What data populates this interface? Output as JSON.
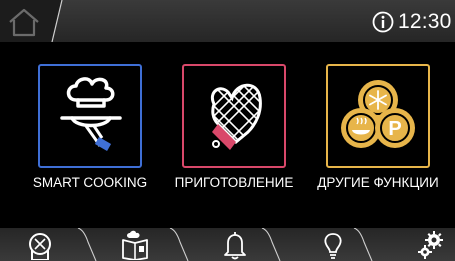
{
  "header": {
    "time": "12:30",
    "icons": [
      "home-icon",
      "info-icon"
    ]
  },
  "tiles": [
    {
      "label": "SMART COOKING",
      "icon": "chef-hat-cloche-icon",
      "color": "#3f6fd6"
    },
    {
      "label": "ПРИГОТОВЛЕНИЕ",
      "icon": "oven-mitt-icon",
      "color": "#d9486a"
    },
    {
      "label": "ДРУГИЕ ФУНКЦИИ",
      "icon": "other-functions-icon",
      "color": "#e7b54a"
    }
  ],
  "bottom_nav": {
    "icons": [
      "oven-icon",
      "recipe-book-icon",
      "bell-icon",
      "lightbulb-icon",
      "settings-icon"
    ]
  },
  "colors": {
    "background": "#000000",
    "bar": "#2a2a2a",
    "blue": "#3f6fd6",
    "red": "#d9486a",
    "gold": "#e7b54a"
  }
}
